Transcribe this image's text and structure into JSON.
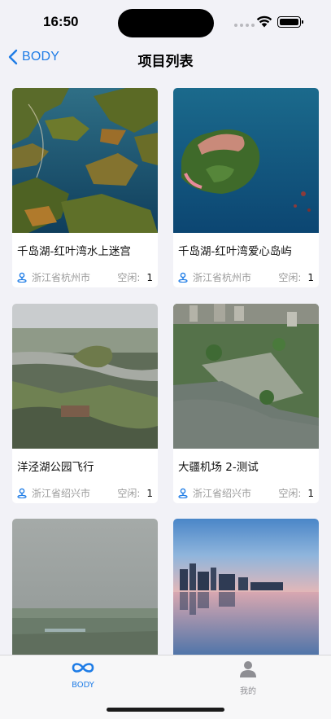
{
  "status_bar": {
    "time": "16:50"
  },
  "nav": {
    "back_label": "BODY",
    "title": "项目列表"
  },
  "cards": [
    {
      "title": "千岛湖-红叶湾水上迷宫",
      "location": "浙江省杭州市",
      "free_label": "空闲:",
      "free_count": "1"
    },
    {
      "title": "千岛湖-红叶湾爱心岛屿",
      "location": "浙江省杭州市",
      "free_label": "空闲:",
      "free_count": "1"
    },
    {
      "title": "洋泾湖公园飞行",
      "location": "浙江省绍兴市",
      "free_label": "空闲:",
      "free_count": "1"
    },
    {
      "title": "大疆机场 2-测试",
      "location": "浙江省绍兴市",
      "free_label": "空闲:",
      "free_count": "1"
    },
    {
      "title": "",
      "location": "",
      "free_label": "",
      "free_count": ""
    },
    {
      "title": "",
      "location": "",
      "free_label": "",
      "free_count": ""
    }
  ],
  "tab_bar": {
    "items": [
      {
        "label": "BODY",
        "icon": "infinity-icon",
        "active": true
      },
      {
        "label": "我的",
        "icon": "person-icon",
        "active": false
      }
    ]
  },
  "colors": {
    "accent": "#1e7ce6",
    "inactive": "#8e8e93",
    "background": "#f2f2f7"
  }
}
